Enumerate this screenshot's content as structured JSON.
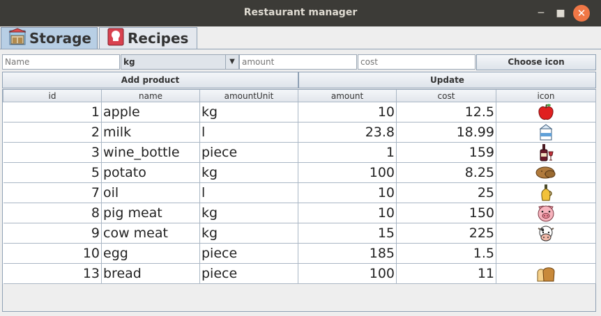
{
  "window": {
    "title": "Restaurant manager"
  },
  "tabs": [
    {
      "label": "Storage",
      "icon": "storage-icon",
      "selected": true
    },
    {
      "label": "Recipes",
      "icon": "recipes-icon",
      "selected": false
    }
  ],
  "form": {
    "name_placeholder": "Name",
    "unit_selected": "kg",
    "amount_placeholder": "amount",
    "cost_placeholder": "cost",
    "choose_icon_label": "Choose icon",
    "add_product_label": "Add product",
    "update_label": "Update"
  },
  "table": {
    "columns": [
      "id",
      "name",
      "amountUnit",
      "amount",
      "cost",
      "icon"
    ],
    "rows": [
      {
        "id": "1",
        "name": "apple",
        "unit": "kg",
        "amount": "10",
        "cost": "12.5",
        "icon": "apple-icon"
      },
      {
        "id": "2",
        "name": "milk",
        "unit": "l",
        "amount": "23.8",
        "cost": "18.99",
        "icon": "milk-carton-icon"
      },
      {
        "id": "3",
        "name": "wine_bottle",
        "unit": "piece",
        "amount": "1",
        "cost": "159",
        "icon": "wine-bottle-icon"
      },
      {
        "id": "5",
        "name": "potato",
        "unit": "kg",
        "amount": "100",
        "cost": "8.25",
        "icon": "potato-icon"
      },
      {
        "id": "7",
        "name": "oil",
        "unit": "l",
        "amount": "10",
        "cost": "25",
        "icon": "oil-bottle-icon"
      },
      {
        "id": "8",
        "name": "pig meat",
        "unit": "kg",
        "amount": "10",
        "cost": "150",
        "icon": "pig-icon"
      },
      {
        "id": "9",
        "name": "cow meat",
        "unit": "kg",
        "amount": "15",
        "cost": "225",
        "icon": "cow-icon"
      },
      {
        "id": "10",
        "name": "egg",
        "unit": "piece",
        "amount": "185",
        "cost": "1.5",
        "icon": ""
      },
      {
        "id": "13",
        "name": "bread",
        "unit": "piece",
        "amount": "100",
        "cost": "11",
        "icon": "bread-icon"
      }
    ]
  },
  "colors": {
    "titlebar": "#3c3b37",
    "close_button": "#f07746",
    "selected_tab": "#b8cfe5"
  }
}
